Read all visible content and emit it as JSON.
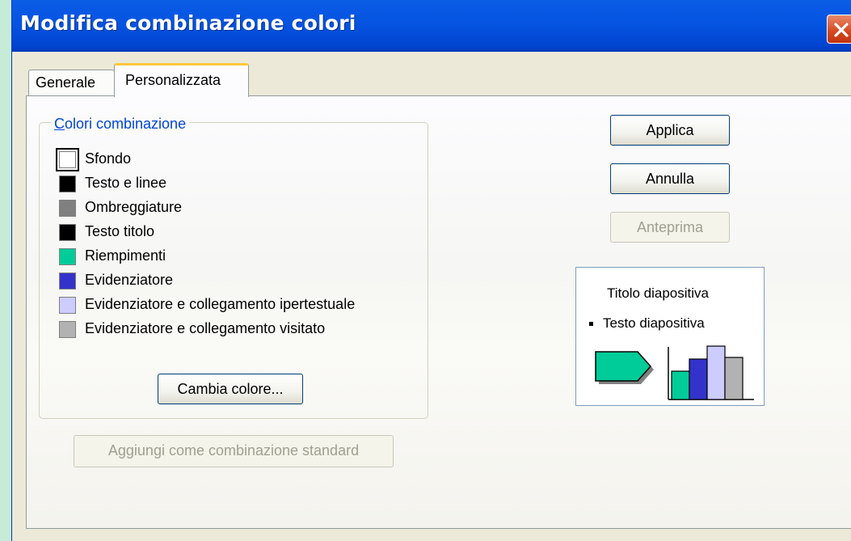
{
  "window": {
    "title": "Modifica combinazione colori"
  },
  "tabs": [
    {
      "label": "Generale",
      "active": false
    },
    {
      "label": "Personalizzata",
      "active": true
    }
  ],
  "group": {
    "legend_first": "C",
    "legend_rest": "olori combinazione",
    "items": [
      {
        "label": "Sfondo",
        "color": "#ffffff",
        "selected": true
      },
      {
        "label": "Testo e linee",
        "color": "#000000"
      },
      {
        "label": "Ombreggiature",
        "color": "#808080"
      },
      {
        "label": "Testo titolo",
        "color": "#000000"
      },
      {
        "label": "Riempimenti",
        "color": "#00cc99"
      },
      {
        "label": "Evidenziatore",
        "color": "#3333cc"
      },
      {
        "label": "Evidenziatore e collegamento ipertestuale",
        "color": "#ccccff"
      },
      {
        "label": "Evidenziatore e collegamento visitato",
        "color": "#b2b2b2"
      }
    ],
    "change_color_button": "Cambia colore..."
  },
  "buttons": {
    "apply": "Applica",
    "cancel": "Annulla",
    "preview": "Anteprima",
    "add_standard": "Aggiungi come combinazione standard"
  },
  "preview": {
    "slide_title": "Titolo diapositiva",
    "slide_text": "Testo diapositiva",
    "colors": {
      "fill": "#00cc99",
      "accent": "#3333cc",
      "hyperlink": "#ccccff",
      "followed": "#b2b2b2",
      "shadow": "#808080"
    }
  }
}
